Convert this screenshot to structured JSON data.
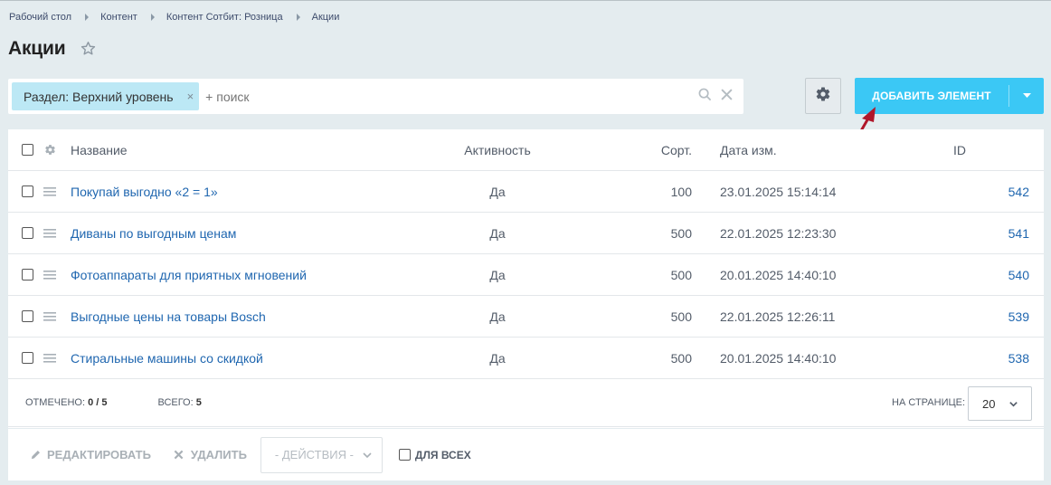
{
  "breadcrumb": [
    "Рабочий стол",
    "Контент",
    "Контент Сотбит: Розница",
    "Акции"
  ],
  "page_title": "Акции",
  "filter": {
    "tag": "Раздел: Верхний уровень",
    "tag_close": "×",
    "placeholder": "+ поиск"
  },
  "toolbar": {
    "add_label": "ДОБАВИТЬ ЭЛЕМЕНТ"
  },
  "grid": {
    "columns": {
      "name": "Название",
      "active": "Активность",
      "sort": "Сорт.",
      "date": "Дата изм.",
      "id": "ID"
    },
    "rows": [
      {
        "name": "Покупай выгодно «2 = 1»",
        "active": "Да",
        "sort": "100",
        "date": "23.01.2025 15:14:14",
        "id": "542"
      },
      {
        "name": "Диваны по выгодным ценам",
        "active": "Да",
        "sort": "500",
        "date": "22.01.2025 12:23:30",
        "id": "541"
      },
      {
        "name": "Фотоаппараты для приятных мгновений",
        "active": "Да",
        "sort": "500",
        "date": "20.01.2025 14:40:10",
        "id": "540"
      },
      {
        "name": "Выгодные цены на товары Bosch",
        "active": "Да",
        "sort": "500",
        "date": "22.01.2025 12:26:11",
        "id": "539"
      },
      {
        "name": "Стиральные машины со скидкой",
        "active": "Да",
        "sort": "500",
        "date": "20.01.2025 14:40:10",
        "id": "538"
      }
    ]
  },
  "footer": {
    "selected_label": "ОТМЕЧЕНО:",
    "selected_value": "0 / 5",
    "total_label": "ВСЕГО:",
    "total_value": "5",
    "per_page_label": "НА СТРАНИЦЕ:",
    "per_page_value": "20"
  },
  "actions": {
    "edit": "РЕДАКТИРОВАТЬ",
    "delete": "УДАЛИТЬ",
    "select_placeholder": "- ДЕЙСТВИЯ -",
    "for_all": "ДЛЯ ВСЕХ"
  },
  "colors": {
    "accent": "#3bc8f5",
    "link": "#2067b0",
    "filter_tag": "#bce8f5",
    "background": "#e4ecef",
    "annotation_arrow": "#b0172a"
  }
}
